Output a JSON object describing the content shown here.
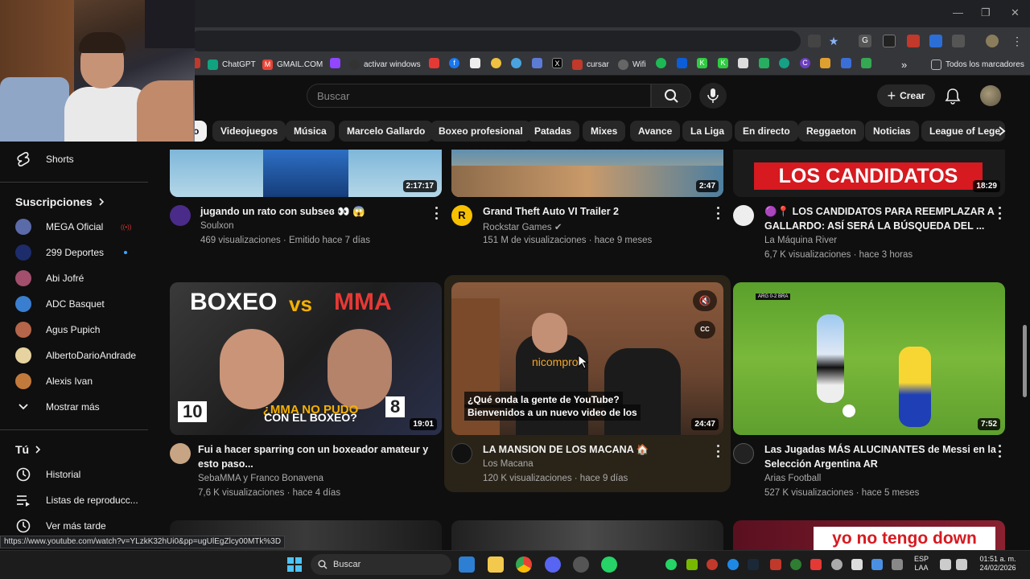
{
  "window": {
    "controls": [
      "—",
      "❐",
      "✕"
    ]
  },
  "bookmarks": [
    {
      "label": "ChatGPT",
      "color": "#10a37f"
    },
    {
      "label": "GMAIL.COM",
      "color": "#ea4335"
    },
    {
      "label": "",
      "color": "#9146ff"
    },
    {
      "label": "activar windows",
      "color": "#333333"
    },
    {
      "label": "cursar",
      "color": "#c0392b"
    },
    {
      "label": "Wifi",
      "color": "#666666"
    },
    {
      "label": "Todos los marcadores",
      "color": "#888888"
    }
  ],
  "header": {
    "search_placeholder": "Buscar",
    "create_label": "Crear"
  },
  "chips": [
    "o",
    "Videojuegos",
    "Música",
    "Marcelo Gallardo",
    "Boxeo profesional",
    "Patadas",
    "Mixes",
    "Avance",
    "La Liga",
    "En directo",
    "Reggaeton",
    "Noticias",
    "League of Lege"
  ],
  "sidebar": {
    "shorts": "Shorts",
    "subscriptions_heading": "Suscripciones",
    "subscriptions": [
      {
        "name": "MEGA Oficial",
        "color": "#5b6aa8",
        "live": true
      },
      {
        "name": "299 Deportes",
        "color": "#1d2c6b",
        "new": true
      },
      {
        "name": "Abi Jofré",
        "color": "#a14f6c"
      },
      {
        "name": "ADC Basquet",
        "color": "#3a7ed0"
      },
      {
        "name": "Agus Pupich",
        "color": "#b5654a"
      },
      {
        "name": "AlbertoDarioAndrade",
        "color": "#e7d3a0"
      },
      {
        "name": "Alexis Ivan",
        "color": "#c27a3c"
      }
    ],
    "show_more": "Mostrar más",
    "you_heading": "Tú",
    "you_items": [
      "Historial",
      "Listas de reproducc...",
      "Ver más tarde"
    ]
  },
  "videos": [
    {
      "title": "jugando un rato con subseɞ 👀 😱",
      "channel": "Soulxon",
      "meta": "469 visualizaciones · Emitido hace 7 días",
      "duration": "2:17:17"
    },
    {
      "title": "Grand Theft Auto VI Trailer 2",
      "channel": "Rockstar Games ✔",
      "meta": "151 M de visualizaciones · hace 9 meses",
      "duration": "2:47"
    },
    {
      "title": "🟣📍 LOS CANDIDATOS PARA REEMPLAZAR A",
      "title2": "GALLARDO: ASÍ SERÁ LA BÚSQUEDA DEL ...",
      "channel": "La Máquina River",
      "meta": "6,7 K visualizaciones · hace 3 horas",
      "duration": "18:29",
      "thumb_text": "LOS CANDIDATOS"
    },
    {
      "title": "Fui a hacer sparring con un boxeador amateur y",
      "title2": "esto paso...",
      "channel": "SebaMMA y Franco Bonavena",
      "meta": "7,6 K visualizaciones · hace 4 días",
      "duration": "19:01",
      "thumb_text_1": "BOXEO",
      "thumb_text_2": "VS",
      "thumb_text_3": "MMA",
      "thumb_text_4": "¿MMA NO PUDO",
      "thumb_text_5": "CON EL BOXEO?",
      "score_left": "10",
      "score_right": "8"
    },
    {
      "title": "LA MANSION DE LOS MACANA 🏠",
      "channel": "Los Macana",
      "meta": "120 K visualizaciones · hace 9 días",
      "duration": "24:47",
      "caption_1": "¿Qué onda la gente de YouTube?",
      "caption_2": "Bienvenidos a un nuevo video de los",
      "shirt_text": "nicompro",
      "cc_label": "CC"
    },
    {
      "title": "Las Jugadas MÁS ALUCINANTES de Messi en la",
      "title2": "Selección Argentina AR",
      "channel": "Arias Football",
      "meta": "527 K visualizaciones · hace 5 meses",
      "duration": "7:52",
      "score_label": "ARG 0-2 BRA"
    },
    {
      "thumb_text": "yo no tengo down"
    }
  ],
  "status_url": "https://www.youtube.com/watch?v=YLzkK32hUi0&pp=ugUlEgZlcy00MTk%3D",
  "taskbar": {
    "search_label": "Buscar",
    "lang_1": "ESP",
    "lang_2": "LAA",
    "time": "01:51 a. m.",
    "date": "24/02/2026"
  }
}
